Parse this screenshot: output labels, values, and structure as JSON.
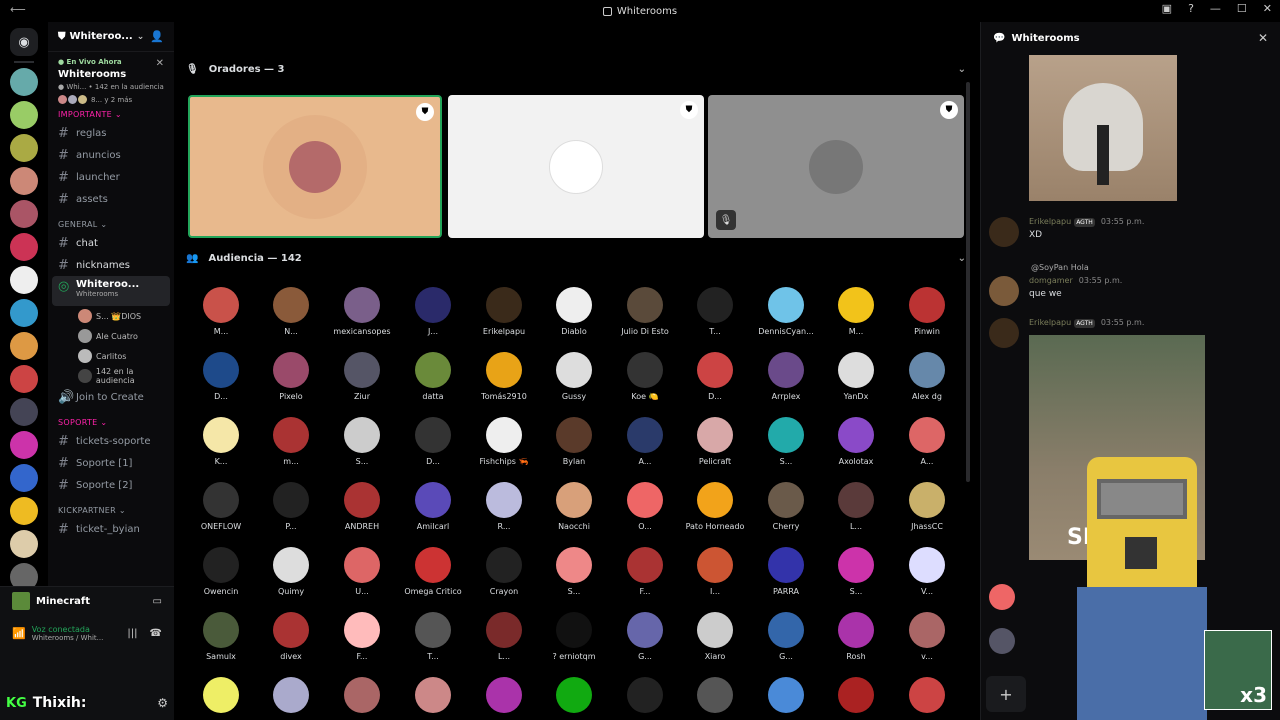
{
  "window": {
    "title": "Whiterooms"
  },
  "server": {
    "name": "Whiteroo...",
    "live_tag": "● En Vivo Ahora",
    "live_name": "Whiterooms",
    "live_sub": "● Whi... • 142 en la audiencia",
    "live_more": "8... y 2 más"
  },
  "categories": {
    "important": "IMPORTANTE",
    "general": "GENERAL",
    "support": "SOPORTE",
    "kick": "KICKPARTNER"
  },
  "channels": {
    "important": [
      "reglas",
      "anuncios",
      "launcher",
      "assets"
    ],
    "general": [
      "chat",
      "nicknames"
    ],
    "support": [
      "tickets-soporte",
      "Soporte [1]",
      "Soporte [2]"
    ],
    "kick": [
      "ticket-_byian"
    ]
  },
  "stage": {
    "name": "Whiteroo...",
    "sub": "Whiterooms",
    "users": [
      "S... 👑DIOS",
      "Ale Cuatro",
      "Carlitos",
      "142 en la audiencia"
    ],
    "join": "Join to Create"
  },
  "user_area": {
    "game": "Minecraft",
    "voice": "Voz conectada",
    "voice_sub": "Whiterooms / Whit...",
    "name": "Thixih:",
    "logo": "KG"
  },
  "speakers": {
    "title": "Oradores — 3"
  },
  "audience": {
    "title": "Audiencia — 142"
  },
  "audience_names": [
    "M...",
    "N...",
    "mexicansopes",
    "J...",
    "Erikelpapu",
    "Diablo",
    "Julio Di Esto",
    "T...",
    "DennisCyan...",
    "M...",
    "Pinwin",
    "D...",
    "Pixelo",
    "Ziur",
    "datta",
    "Tomás2910",
    "Gussy",
    "Koe 🍋",
    "D...",
    "Arrplex",
    "YanDx",
    "Alex dg",
    "K...",
    "m...",
    "S...",
    "D...",
    "Fishchips 🦐",
    "Bylan",
    "A...",
    "Pelicraft",
    "S...",
    "Axolotax",
    "A...",
    "ONEFLOW",
    "P...",
    "ANDREH",
    "Amilcarl",
    "R...",
    "Naocchi",
    "O...",
    "Pato Horneado",
    "Cherry",
    "L...",
    "JhassCC",
    "Owencin",
    "Quimy",
    "U...",
    "Omega Critico",
    "Crayon",
    "S...",
    "F...",
    "I...",
    "PARRA",
    "S...",
    "V...",
    "Samulx",
    "divex",
    "F...",
    "T...",
    "L...",
    "? erniotqm",
    "G...",
    "Xiaro",
    "G...",
    "Rosh",
    "v...",
    "",
    "",
    "",
    "",
    "",
    "",
    "",
    "",
    "",
    "",
    ""
  ],
  "audience_colors": [
    "#c9524a",
    "#8a5a3a",
    "#7a5f8a",
    "#2a2a6a",
    "#3a2a1a",
    "#eee",
    "#5a4a3a",
    "#222",
    "#6fc3e8",
    "#f2c31a",
    "#b33",
    "#1e4a8a",
    "#9a4a6a",
    "#556",
    "#6a8a3a",
    "#e8a317",
    "#ddd",
    "#333",
    "#c44",
    "#6a4a8a",
    "#ddd",
    "#68a",
    "#f5e7a8",
    "#a33",
    "#ccc",
    "#333",
    "#eee",
    "#5a3a2a",
    "#2a3a6a",
    "#d8a8a8",
    "#2aa",
    "#8a4ac8",
    "#d66",
    "#333",
    "#222",
    "#a33",
    "#5a4ab8",
    "#bbd",
    "#d8a07a",
    "#e66",
    "#f2a31a",
    "#6a5a4a",
    "#5a3a3a",
    "#c9b06a",
    "#222",
    "#ddd",
    "#d66",
    "#c33",
    "#222",
    "#e88",
    "#a33",
    "#c53",
    "#33a",
    "#c3a",
    "#ddf",
    "#4a5a3a",
    "#a33",
    "#fbb",
    "#555",
    "#7a2a2a",
    "#111",
    "#66a",
    "#ccc",
    "#36a",
    "#a3a",
    "#a66",
    "#ee6",
    "#aac",
    "#a66",
    "#c88",
    "#a3a",
    "#1a1",
    "#222",
    "#555",
    "#4a8ad8",
    "#a22",
    "#c44"
  ],
  "chat": {
    "title": "Whiterooms",
    "msg1": {
      "user": "Erikelpapu",
      "badge": "AGTH",
      "time": "03:55 p.m.",
      "text": "XD"
    },
    "reply": "@SoyPan Hola",
    "msg2": {
      "user": "domgamer",
      "time": "03:55 p.m.",
      "text": "que we"
    },
    "msg3": {
      "user": "Erikelpapu",
      "badge": "AGTH",
      "time": "03:55 p.m."
    },
    "overlay_text": "SI",
    "overlay_x3": "x3",
    "plus": "+"
  }
}
